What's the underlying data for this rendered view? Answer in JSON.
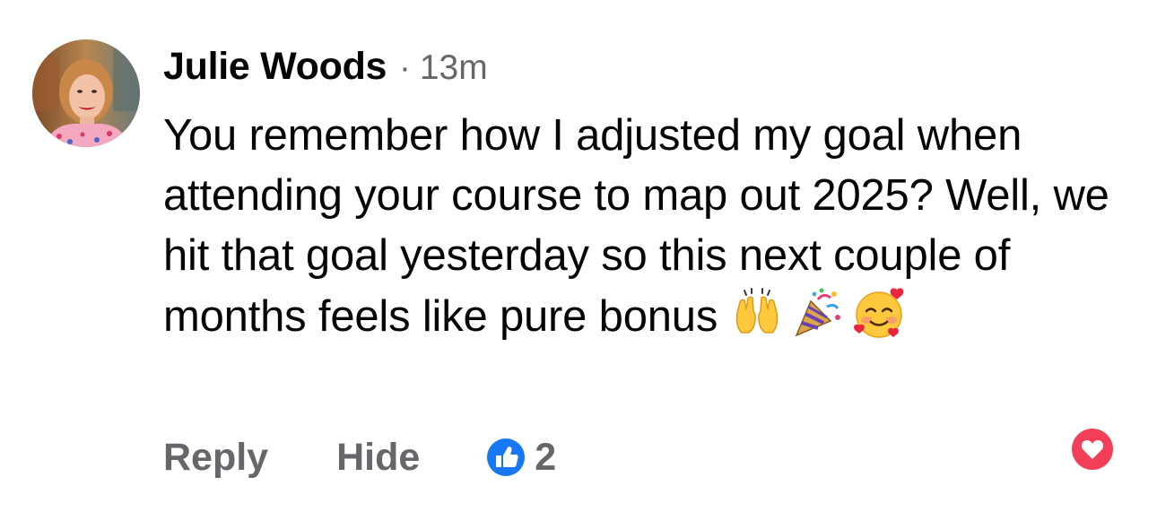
{
  "comment": {
    "author": "Julie Woods",
    "separator": "·",
    "timestamp": "13m",
    "text": "You remember how I adjusted my goal when attending your course to map out 2025? Well, we hit that goal yesterday so this next couple of months feels like pure bonus",
    "emojis": [
      "raising-hands-emoji",
      "party-popper-emoji",
      "smiling-face-with-hearts-emoji"
    ]
  },
  "actions": {
    "reply_label": "Reply",
    "hide_label": "Hide",
    "like_count": "2",
    "like_icon": "like-thumbs-up-icon",
    "love_icon": "heart-icon"
  },
  "colors": {
    "author_text": "#050505",
    "secondary_text": "#65676b",
    "like_blue": "#1877f2",
    "love_red": "#f33e58"
  }
}
